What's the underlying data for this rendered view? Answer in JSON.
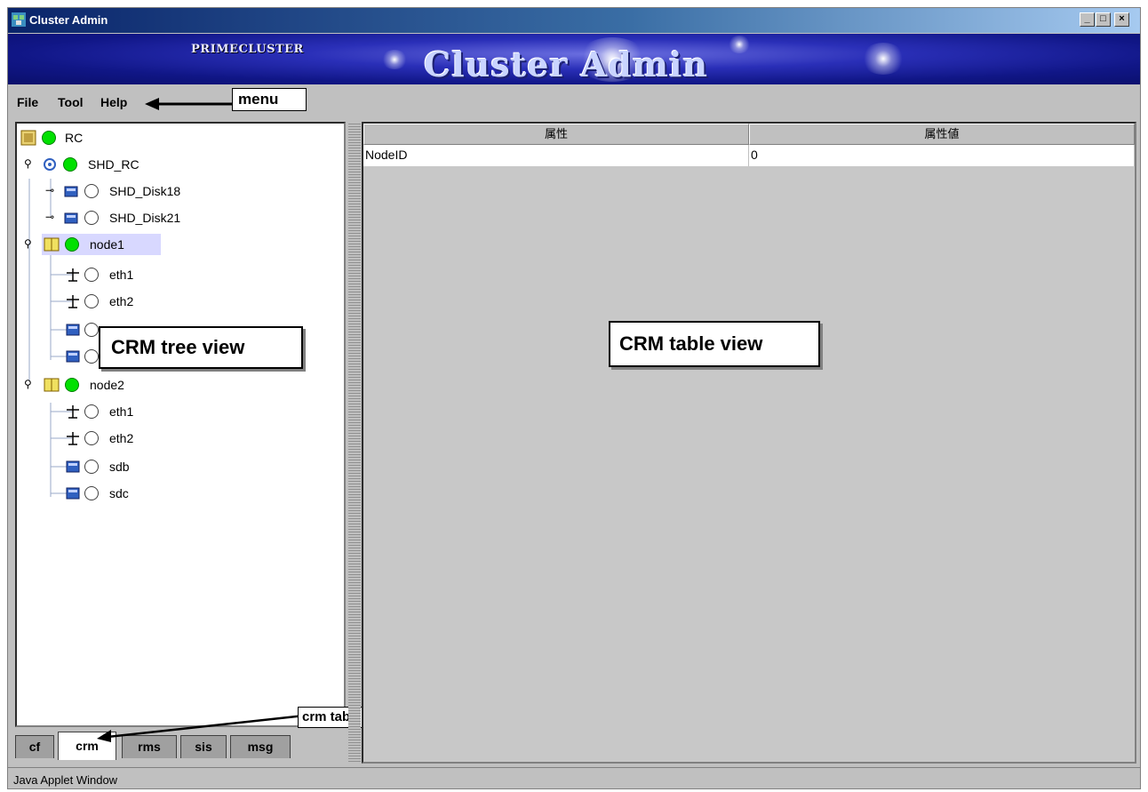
{
  "window": {
    "title": "Cluster Admin",
    "controls": {
      "minimize": "_",
      "maximize": "□",
      "close": "×"
    }
  },
  "banner": {
    "brand": "PRIMECLUSTER",
    "title": "Cluster Admin"
  },
  "menu": {
    "items": [
      "File",
      "Tool",
      "Help"
    ],
    "callout": "menu"
  },
  "tree": {
    "rows": [
      {
        "label": "RC",
        "status": "online",
        "icon": "cluster-icon",
        "expander": ""
      },
      {
        "label": "SHD_RC",
        "status": "online",
        "icon": "shared-resource-icon",
        "expander": "expanded"
      },
      {
        "label": "SHD_Disk18",
        "status": "offline",
        "icon": "shared-disk-icon",
        "expander": "collapsed"
      },
      {
        "label": "SHD_Disk21",
        "status": "offline",
        "icon": "shared-disk-icon",
        "expander": "collapsed"
      },
      {
        "label": "node1",
        "status": "online",
        "icon": "node-icon",
        "expander": "expanded",
        "selected": true
      },
      {
        "label": "eth1",
        "status": "offline",
        "icon": "network-icon"
      },
      {
        "label": "eth2",
        "status": "offline",
        "icon": "network-icon"
      },
      {
        "label": "",
        "status": "offline",
        "icon": "disk-icon"
      },
      {
        "label": "",
        "status": "offline",
        "icon": "disk-icon"
      },
      {
        "label": "node2",
        "status": "online",
        "icon": "node-icon",
        "expander": "expanded"
      },
      {
        "label": "eth1",
        "status": "offline",
        "icon": "network-icon"
      },
      {
        "label": "eth2",
        "status": "offline",
        "icon": "network-icon"
      },
      {
        "label": "sdb",
        "status": "offline",
        "icon": "disk-icon"
      },
      {
        "label": "sdc",
        "status": "offline",
        "icon": "disk-icon"
      }
    ],
    "callout": "CRM tree view"
  },
  "tabs": {
    "items": [
      "cf",
      "crm",
      "rms",
      "sis",
      "msg"
    ],
    "active": "crm",
    "callout": "crm tab"
  },
  "table": {
    "columns": [
      "属性",
      "属性値"
    ],
    "rows": [
      [
        "NodeID",
        "0"
      ]
    ],
    "callout": "CRM table view"
  },
  "status": {
    "text": "Java Applet Window"
  },
  "colors": {
    "online": "#00e000",
    "titlebar": "#0a246a",
    "banner": "#101686",
    "selected": "#d8d8ff"
  }
}
